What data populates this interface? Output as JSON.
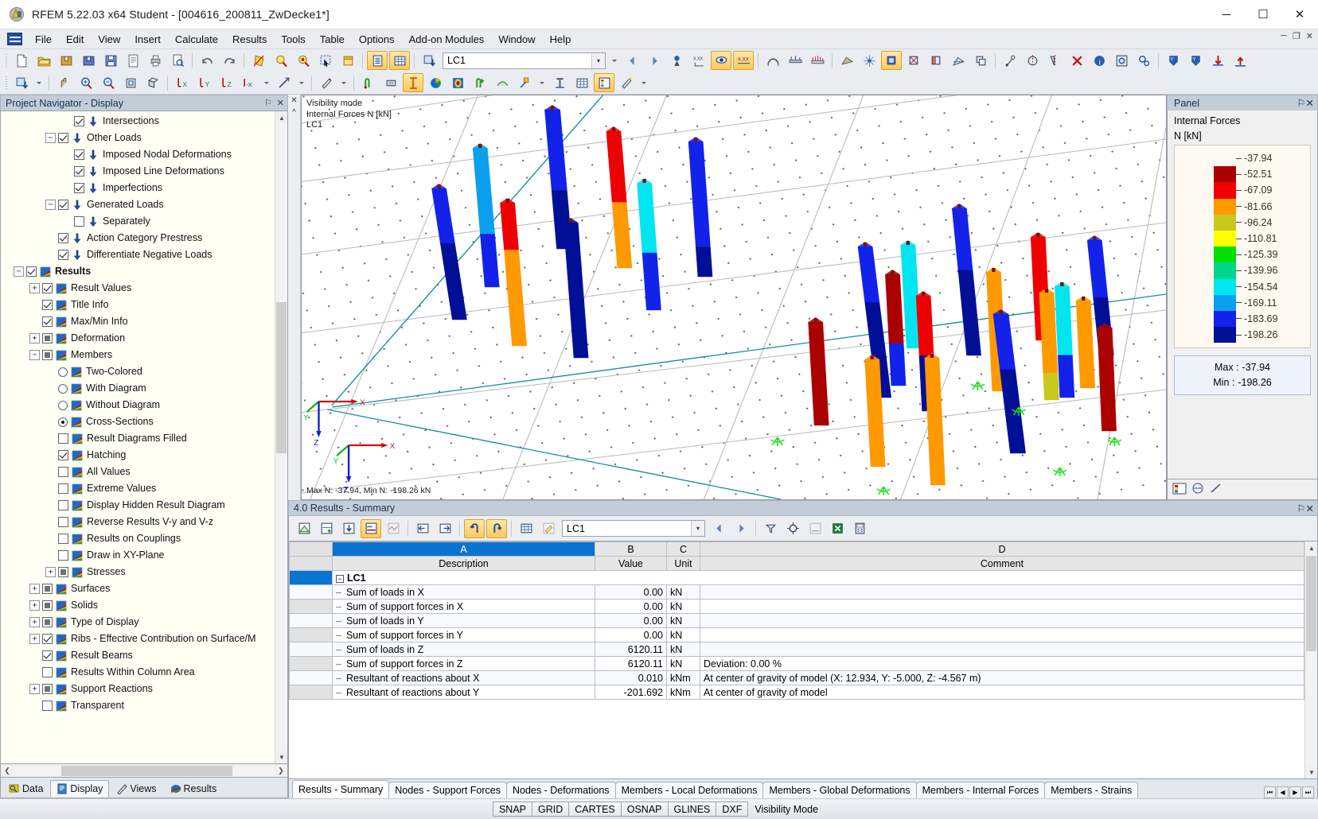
{
  "window": {
    "title": "RFEM 5.22.03 x64 Student - [004616_200811_ZwDecke1*]",
    "minimize": "─",
    "maximize": "☐",
    "close": "✕"
  },
  "menubar": {
    "items": [
      "File",
      "Edit",
      "View",
      "Insert",
      "Calculate",
      "Results",
      "Tools",
      "Table",
      "Options",
      "Add-on Modules",
      "Window",
      "Help"
    ],
    "mdi_minimize": "─",
    "mdi_restore": "❐",
    "mdi_close": "✕"
  },
  "toolbar": {
    "load_case_value": "LC1",
    "dropdown_arrow": "▾"
  },
  "navigator": {
    "title": "Project Navigator - Display",
    "pin_icon": "⚐",
    "close_icon": "✕",
    "scroll_up": "▲",
    "scroll_down": "▼",
    "scroll_left": "❮",
    "scroll_right": "❯",
    "tree": [
      {
        "label": "Intersections",
        "indent": 3,
        "expander": "none",
        "control": "checkbox",
        "state": "checked",
        "icon": "load"
      },
      {
        "label": "Other Loads",
        "indent": 2,
        "expander": "minus",
        "control": "checkbox",
        "state": "checked",
        "icon": "load"
      },
      {
        "label": "Imposed Nodal Deformations",
        "indent": 3,
        "expander": "none",
        "control": "checkbox",
        "state": "checked",
        "icon": "load"
      },
      {
        "label": "Imposed Line Deformations",
        "indent": 3,
        "expander": "none",
        "control": "checkbox",
        "state": "checked",
        "icon": "load"
      },
      {
        "label": "Imperfections",
        "indent": 3,
        "expander": "none",
        "control": "checkbox",
        "state": "checked",
        "icon": "load"
      },
      {
        "label": "Generated Loads",
        "indent": 2,
        "expander": "minus",
        "control": "checkbox",
        "state": "checked",
        "icon": "load"
      },
      {
        "label": "Separately",
        "indent": 3,
        "expander": "none",
        "control": "checkbox",
        "state": "unchecked",
        "icon": "load"
      },
      {
        "label": "Action Category Prestress",
        "indent": 2,
        "expander": "none",
        "control": "checkbox",
        "state": "checked",
        "icon": "load"
      },
      {
        "label": "Differentiate Negative Loads",
        "indent": 2,
        "expander": "none",
        "control": "checkbox",
        "state": "checked",
        "icon": "load"
      },
      {
        "label": "Results",
        "indent": 0,
        "expander": "minus",
        "control": "checkbox",
        "state": "checked",
        "icon": "result",
        "bold": true
      },
      {
        "label": "Result Values",
        "indent": 1,
        "expander": "plus",
        "control": "checkbox",
        "state": "checked",
        "icon": "result"
      },
      {
        "label": "Title Info",
        "indent": 1,
        "expander": "none",
        "control": "checkbox",
        "state": "checked",
        "icon": "result"
      },
      {
        "label": "Max/Min Info",
        "indent": 1,
        "expander": "none",
        "control": "checkbox",
        "state": "checked",
        "icon": "result"
      },
      {
        "label": "Deformation",
        "indent": 1,
        "expander": "plus",
        "control": "checkbox",
        "state": "partial",
        "icon": "result"
      },
      {
        "label": "Members",
        "indent": 1,
        "expander": "minus",
        "control": "checkbox",
        "state": "partial",
        "icon": "result"
      },
      {
        "label": "Two-Colored",
        "indent": 2,
        "expander": "none",
        "control": "radio",
        "state": "off",
        "icon": "result"
      },
      {
        "label": "With Diagram",
        "indent": 2,
        "expander": "none",
        "control": "radio",
        "state": "off",
        "icon": "result"
      },
      {
        "label": "Without Diagram",
        "indent": 2,
        "expander": "none",
        "control": "radio",
        "state": "off",
        "icon": "result"
      },
      {
        "label": "Cross-Sections",
        "indent": 2,
        "expander": "none",
        "control": "radio",
        "state": "on",
        "icon": "result"
      },
      {
        "label": "Result Diagrams Filled",
        "indent": 2,
        "expander": "none",
        "control": "checkbox",
        "state": "unchecked",
        "icon": "result"
      },
      {
        "label": "Hatching",
        "indent": 2,
        "expander": "none",
        "control": "checkbox",
        "state": "checked",
        "icon": "result"
      },
      {
        "label": "All Values",
        "indent": 2,
        "expander": "none",
        "control": "checkbox",
        "state": "unchecked",
        "icon": "result"
      },
      {
        "label": "Extreme Values",
        "indent": 2,
        "expander": "none",
        "control": "checkbox",
        "state": "unchecked",
        "icon": "result"
      },
      {
        "label": "Display Hidden Result Diagram",
        "indent": 2,
        "expander": "none",
        "control": "checkbox",
        "state": "unchecked",
        "icon": "result"
      },
      {
        "label": "Reverse Results V-y and V-z",
        "indent": 2,
        "expander": "none",
        "control": "checkbox",
        "state": "unchecked",
        "icon": "result"
      },
      {
        "label": "Results on Couplings",
        "indent": 2,
        "expander": "none",
        "control": "checkbox",
        "state": "unchecked",
        "icon": "result"
      },
      {
        "label": "Draw in XY-Plane",
        "indent": 2,
        "expander": "none",
        "control": "checkbox",
        "state": "unchecked",
        "icon": "result"
      },
      {
        "label": "Stresses",
        "indent": 2,
        "expander": "plus",
        "control": "checkbox",
        "state": "partial",
        "icon": "result"
      },
      {
        "label": "Surfaces",
        "indent": 1,
        "expander": "plus",
        "control": "checkbox",
        "state": "partial",
        "icon": "result"
      },
      {
        "label": "Solids",
        "indent": 1,
        "expander": "plus",
        "control": "checkbox",
        "state": "partial",
        "icon": "result"
      },
      {
        "label": "Type of Display",
        "indent": 1,
        "expander": "plus",
        "control": "checkbox",
        "state": "partial",
        "icon": "result"
      },
      {
        "label": "Ribs - Effective Contribution on Surface/M",
        "indent": 1,
        "expander": "plus",
        "control": "checkbox",
        "state": "checked",
        "icon": "result"
      },
      {
        "label": "Result Beams",
        "indent": 1,
        "expander": "none",
        "control": "checkbox",
        "state": "checked",
        "icon": "result"
      },
      {
        "label": "Results Within Column Area",
        "indent": 1,
        "expander": "none",
        "control": "checkbox",
        "state": "unchecked",
        "icon": "result"
      },
      {
        "label": "Support Reactions",
        "indent": 1,
        "expander": "plus",
        "control": "checkbox",
        "state": "partial",
        "icon": "result"
      },
      {
        "label": "Transparent",
        "indent": 1,
        "expander": "none",
        "control": "checkbox",
        "state": "unchecked",
        "icon": "result"
      }
    ],
    "tabs": [
      {
        "label": "Data",
        "icon": "data-icon",
        "selected": false
      },
      {
        "label": "Display",
        "icon": "display-icon",
        "selected": true
      },
      {
        "label": "Views",
        "icon": "views-icon",
        "selected": false
      },
      {
        "label": "Results",
        "icon": "results-icon",
        "selected": false
      }
    ]
  },
  "viewport": {
    "overlay_lines": [
      "Visibility mode",
      "Internal Forces N [kN]",
      "LC1"
    ],
    "minmax_text": "Max N: -37.94, Min N: -198.26 kN",
    "axis_labels": {
      "x": "X",
      "y": "Y",
      "z": "Z"
    }
  },
  "panel": {
    "title": "Panel",
    "pin_icon": "⚐",
    "close_icon": "✕",
    "heading": "Internal Forces",
    "unit": "N [kN]",
    "legend": [
      {
        "value": "-37.94",
        "color": "#aa0000"
      },
      {
        "value": "-52.51",
        "color": "#ee0000"
      },
      {
        "value": "-67.09",
        "color": "#ff9900"
      },
      {
        "value": "-81.66",
        "color": "#c8c81e"
      },
      {
        "value": "-96.24",
        "color": "#ffff00"
      },
      {
        "value": "-110.81",
        "color": "#00e000"
      },
      {
        "value": "-125.39",
        "color": "#00d68c"
      },
      {
        "value": "-139.96",
        "color": "#00e5f0"
      },
      {
        "value": "-154.54",
        "color": "#0aa0ee"
      },
      {
        "value": "-169.11",
        "color": "#1322e8"
      },
      {
        "value": "-183.69",
        "color": "#000f96"
      },
      {
        "value": "-198.26",
        "color": "#000f96"
      }
    ],
    "max_label": "Max :",
    "max_value": "-37.94",
    "min_label": "Min :",
    "min_value": "-198.26"
  },
  "table": {
    "title": "4.0 Results - Summary",
    "pin_icon": "⚐",
    "close_icon": "✕",
    "load_case_value": "LC1",
    "dropdown_arrow": "▾",
    "prev_arrow": "◀",
    "next_arrow": "▶",
    "column_letters": [
      "",
      "A",
      "B",
      "C",
      "D"
    ],
    "column_headers": [
      "",
      "Description",
      "Value",
      "Unit",
      "Comment"
    ],
    "group_row": "LC1",
    "rows": [
      {
        "description": "Sum of loads in X",
        "value": "0.00",
        "unit": "kN",
        "comment": ""
      },
      {
        "description": "Sum of support forces in X",
        "value": "0.00",
        "unit": "kN",
        "comment": ""
      },
      {
        "description": "Sum of loads in Y",
        "value": "0.00",
        "unit": "kN",
        "comment": ""
      },
      {
        "description": "Sum of support forces in Y",
        "value": "0.00",
        "unit": "kN",
        "comment": ""
      },
      {
        "description": "Sum of loads in Z",
        "value": "6120.11",
        "unit": "kN",
        "comment": ""
      },
      {
        "description": "Sum of support forces in Z",
        "value": "6120.11",
        "unit": "kN",
        "comment": "Deviation: 0.00 %"
      },
      {
        "description": "Resultant of reactions about X",
        "value": "0.010",
        "unit": "kNm",
        "comment": "At center of gravity of model (X: 12.934, Y: -5.000, Z: -4.567 m)"
      },
      {
        "description": "Resultant of reactions about Y",
        "value": "-201.692",
        "unit": "kNm",
        "comment": "At center of gravity of model"
      }
    ],
    "tabs": [
      {
        "label": "Results - Summary",
        "selected": true
      },
      {
        "label": "Nodes - Support Forces",
        "selected": false
      },
      {
        "label": "Nodes - Deformations",
        "selected": false
      },
      {
        "label": "Members - Local Deformations",
        "selected": false
      },
      {
        "label": "Members - Global Deformations",
        "selected": false
      },
      {
        "label": "Members - Internal Forces",
        "selected": false
      },
      {
        "label": "Members - Strains",
        "selected": false
      }
    ],
    "nav_buttons": [
      "⏮",
      "◀",
      "▶",
      "⏭"
    ]
  },
  "statusbar": {
    "segments": [
      "SNAP",
      "GRID",
      "CARTES",
      "OSNAP",
      "GLINES",
      "DXF"
    ],
    "mode_text": "Visibility Mode"
  }
}
